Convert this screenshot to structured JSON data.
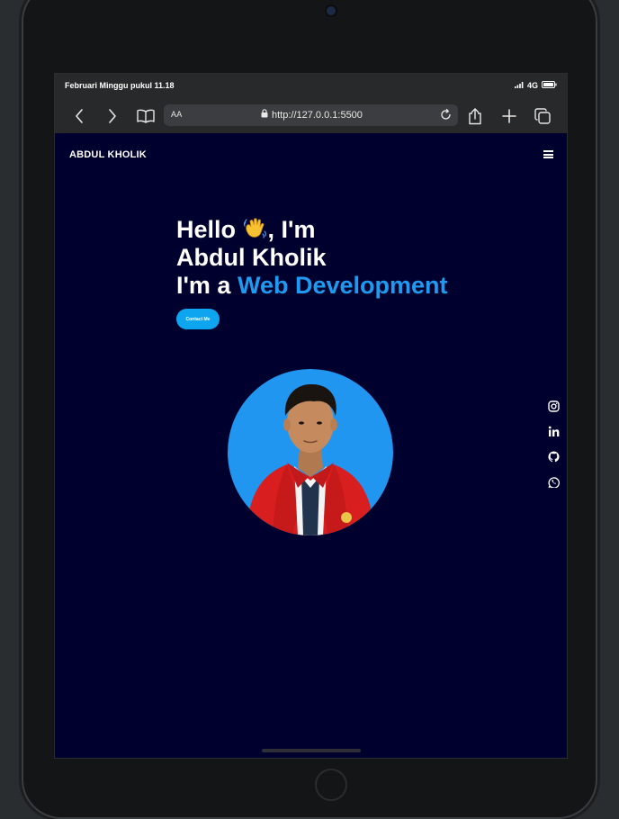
{
  "status": {
    "datetime": "Februari Minggu pukul 11.18",
    "network": "4G"
  },
  "browser": {
    "reader_label": "AA",
    "url": "http://127.0.0.1:5500"
  },
  "site": {
    "brand": "ABDUL KHOLIK",
    "hero": {
      "line1_a": "Hello",
      "line1_b": ", I'm",
      "line2": "Abdul Kholik",
      "line3_a": "I'm a",
      "line3_accent": "Web Development"
    },
    "contact_label": "Contact Me",
    "socials": [
      "instagram-icon",
      "linkedin-icon",
      "github-icon",
      "whatsapp-icon"
    ]
  },
  "colors": {
    "page_bg": "#00002e",
    "accent": "#1e9bf0",
    "button": "#0ea5f0",
    "portrait_bg": "#2196f0",
    "jacket": "#d81e1e"
  }
}
